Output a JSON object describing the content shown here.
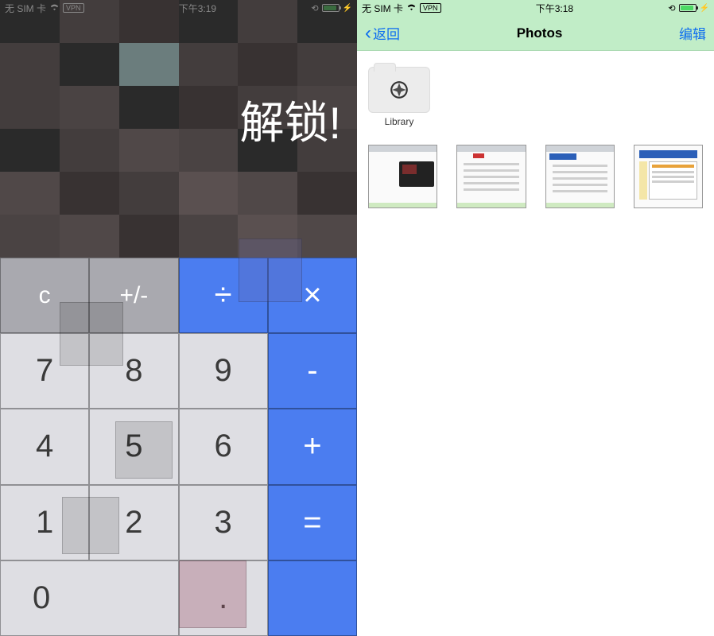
{
  "left": {
    "status": {
      "carrier": "无 SIM 卡",
      "vpn": "VPN",
      "time": "下午3:19"
    },
    "unlock_text": "解锁!",
    "keys": {
      "clear": "c",
      "plusminus": "+/-",
      "divide": "÷",
      "multiply": "×",
      "k7": "7",
      "k8": "8",
      "k9": "9",
      "minus": "-",
      "k4": "4",
      "k5": "5",
      "k6": "6",
      "plus": "+",
      "k1": "1",
      "k2": "2",
      "k3": "3",
      "equals": "=",
      "k0": "0",
      "dot": "."
    }
  },
  "right": {
    "status": {
      "carrier": "无 SIM 卡",
      "vpn": "VPN",
      "time": "下午3:18"
    },
    "nav": {
      "back": "返回",
      "title": "Photos",
      "edit": "编辑"
    },
    "folder_label": "Library"
  }
}
